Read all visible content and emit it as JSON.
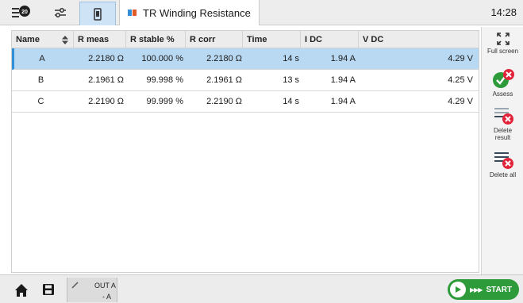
{
  "topbar": {
    "notification_count": "20",
    "tab_title": "TR Winding Resistance",
    "clock": "14:28"
  },
  "table": {
    "columns": [
      "Name",
      "R meas",
      "R stable %",
      "R corr",
      "Time",
      "I DC",
      "V DC"
    ],
    "rows": [
      {
        "name": "A",
        "r_meas": "2.2180 Ω",
        "r_stable": "100.000 %",
        "r_corr": "2.2180 Ω",
        "time": "14 s",
        "i_dc": "1.94 A",
        "v_dc": "4.29 V",
        "selected": true
      },
      {
        "name": "B",
        "r_meas": "2.1961 Ω",
        "r_stable": "99.998 %",
        "r_corr": "2.1961 Ω",
        "time": "13 s",
        "i_dc": "1.94 A",
        "v_dc": "4.25 V",
        "selected": false
      },
      {
        "name": "C",
        "r_meas": "2.2190 Ω",
        "r_stable": "99.999 %",
        "r_corr": "2.2190 Ω",
        "time": "14 s",
        "i_dc": "1.94 A",
        "v_dc": "4.29 V",
        "selected": false
      }
    ]
  },
  "side": {
    "full_screen": "Full screen",
    "assess": "Assess",
    "delete_result_1": "Delete",
    "delete_result_2": "result",
    "delete_all": "Delete all"
  },
  "bottom": {
    "out_line1": "OUT A",
    "out_line2": "- A",
    "start": "START"
  },
  "colors": {
    "accent": "#2f8fd8",
    "selected_row": "#b9d8f1",
    "start_green": "#2e9b3b",
    "delete_red": "#e2243a",
    "assess_green": "#2e9b3b"
  }
}
